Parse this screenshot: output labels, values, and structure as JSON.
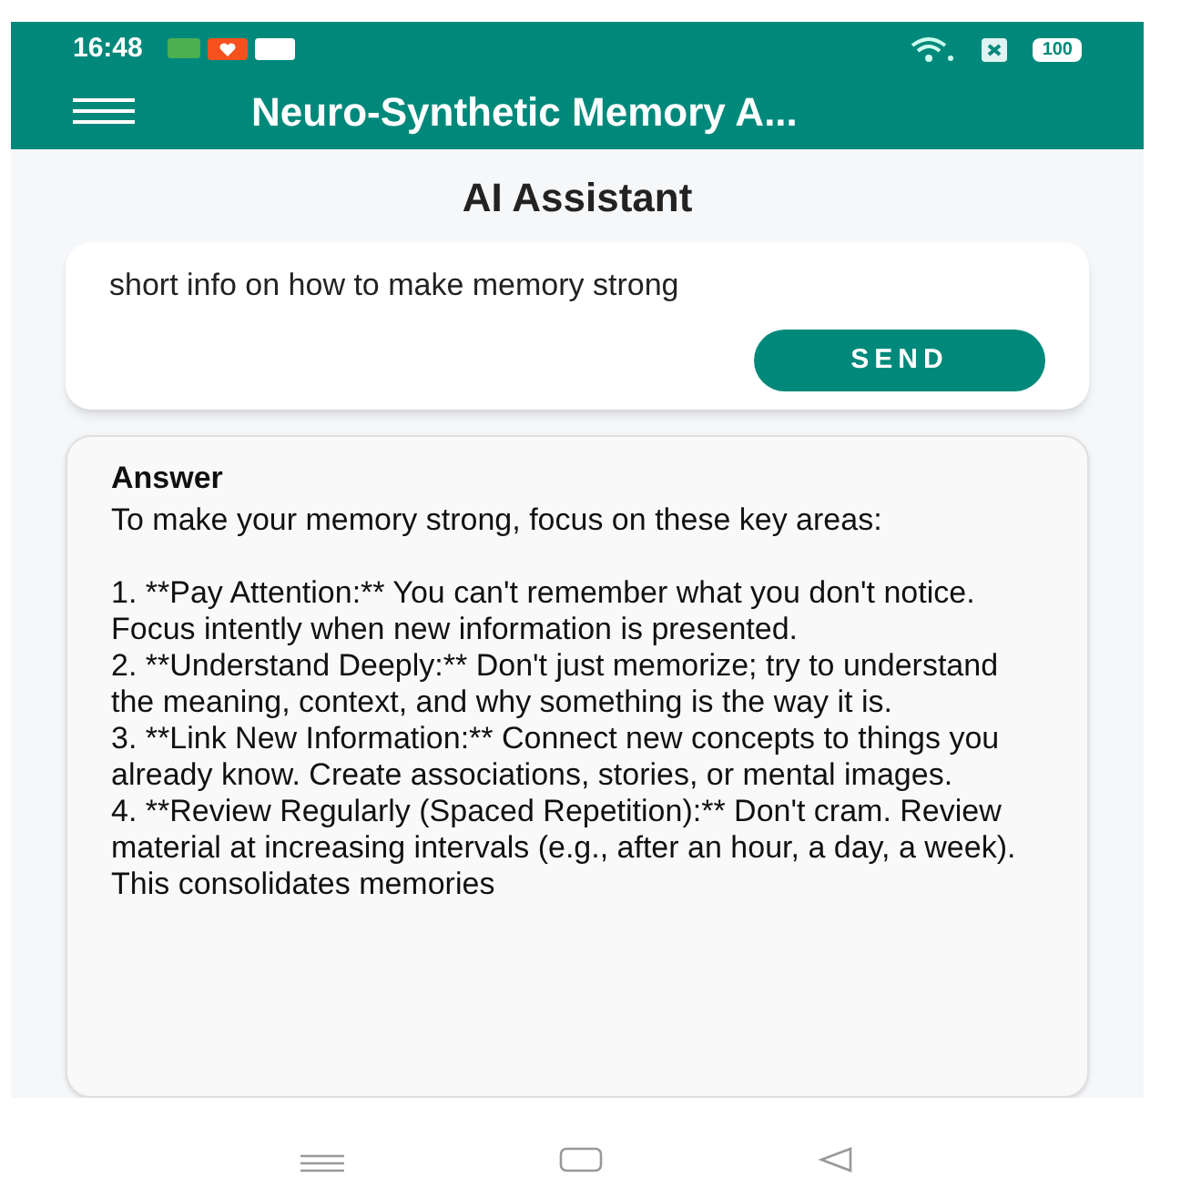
{
  "status_bar": {
    "time": "16:48",
    "battery": "100"
  },
  "app_bar": {
    "title": "Neuro-Synthetic Memory A..."
  },
  "page_title": "AI Assistant",
  "question": {
    "value": "short info on how to make memory strong",
    "send": "SEND"
  },
  "answer": {
    "heading": "Answer",
    "intro": "To make your memory strong, focus on these key areas:",
    "points": [
      "1.  **Pay Attention:** You can't remember what you don't notice. Focus intently when new information is presented.",
      "2.  **Understand Deeply:** Don't just memorize; try to understand the meaning, context, and why something is the way it is.",
      "3.  **Link New Information:** Connect new concepts to things you already know. Create associations, stories, or mental images.",
      "4.  **Review Regularly (Spaced Repetition):** Don't cram. Review material at increasing intervals (e.g., after an hour, a day, a week). This consolidates memories"
    ]
  }
}
